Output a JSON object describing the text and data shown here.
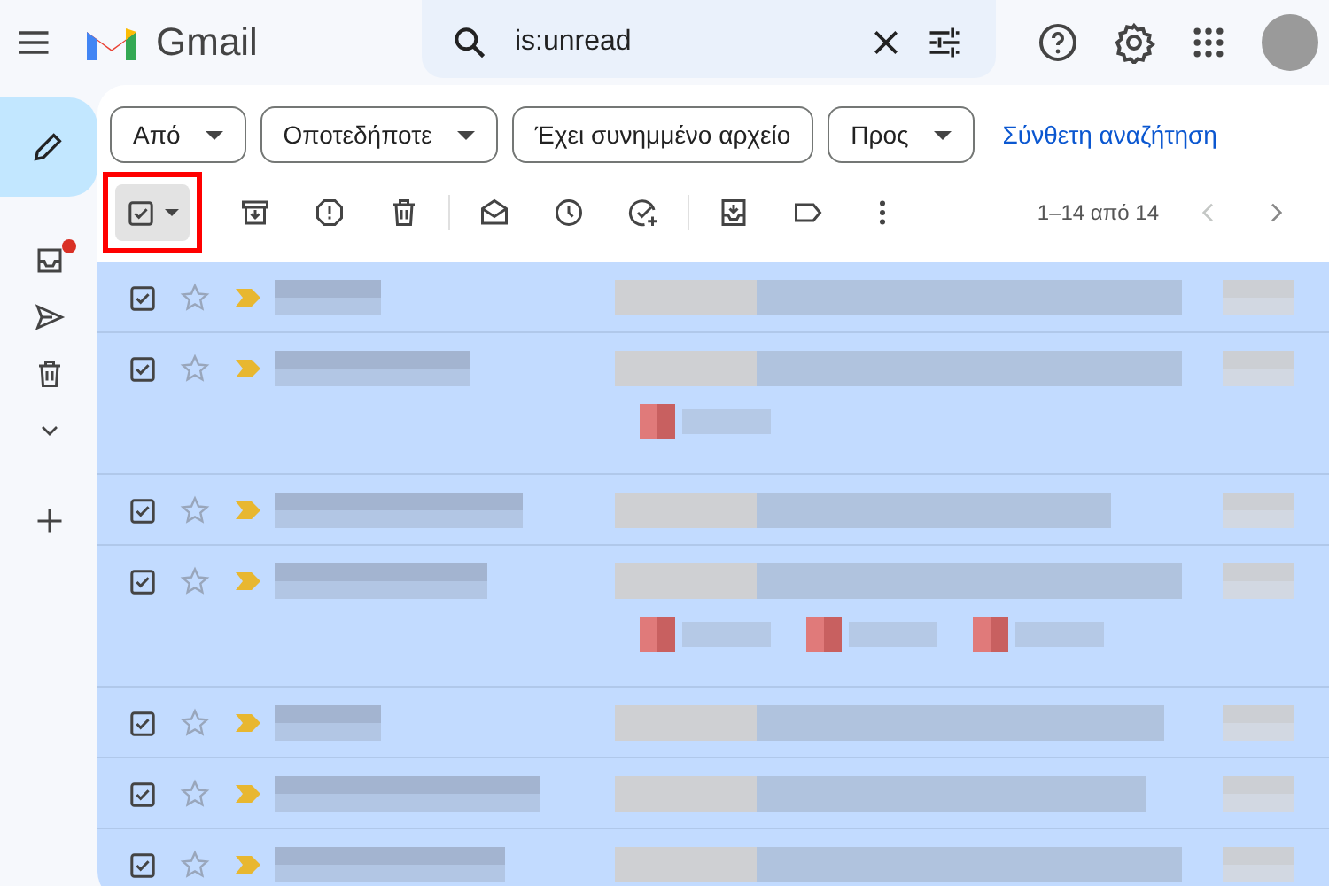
{
  "header": {
    "app_name": "Gmail",
    "search": {
      "value": "is:unread"
    }
  },
  "sidebar": {
    "items": [
      {
        "kind": "inbox",
        "notification": true
      },
      {
        "kind": "sent",
        "notification": false
      },
      {
        "kind": "trash",
        "notification": false
      },
      {
        "kind": "more",
        "notification": false
      }
    ]
  },
  "filters": {
    "chips": [
      {
        "label": "Από",
        "dropdown": true
      },
      {
        "label": "Οποτεδήποτε",
        "dropdown": true
      },
      {
        "label": "Έχει συνημμένο αρχείο",
        "dropdown": false
      },
      {
        "label": "Προς",
        "dropdown": true
      }
    ],
    "advanced_search": "Σύνθετη αναζήτηση"
  },
  "toolbar": {
    "select_all": {
      "checked": true,
      "highlighted": true
    },
    "pagination": {
      "range": "1–14 από 14",
      "prev_disabled": true,
      "next_disabled": false
    }
  },
  "messages": [
    {
      "selected": true,
      "starred": false,
      "important": true
    },
    {
      "selected": true,
      "starred": false,
      "important": true,
      "attachments": [
        {
          "kind": "image"
        }
      ]
    },
    {
      "selected": true,
      "starred": false,
      "important": true
    },
    {
      "selected": true,
      "starred": false,
      "important": true,
      "attachments": [
        {
          "kind": "image"
        },
        {
          "kind": "image"
        },
        {
          "kind": "image"
        }
      ]
    },
    {
      "selected": true,
      "starred": false,
      "important": true
    },
    {
      "selected": true,
      "starred": false,
      "important": true
    },
    {
      "selected": true,
      "starred": false,
      "important": true
    }
  ]
}
